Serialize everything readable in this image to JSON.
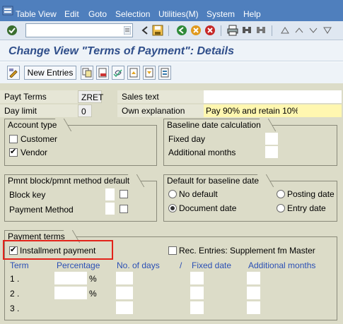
{
  "menu": {
    "items": [
      "Table View",
      "Edit",
      "Goto",
      "Selection",
      "Utilities(M)",
      "System",
      "Help"
    ]
  },
  "title": "Change View \"Terms of Payment\": Details",
  "app_toolbar": {
    "new_entries": "New Entries"
  },
  "fields": {
    "payt_terms": {
      "label": "Payt Terms",
      "value": "ZRET"
    },
    "sales_text": {
      "label": "Sales text",
      "value": ""
    },
    "day_limit": {
      "label": "Day limit",
      "value": "0"
    },
    "own_explanation": {
      "label": "Own explanation",
      "value": "Pay 90% and retain 10%"
    }
  },
  "account_type": {
    "title": "Account type",
    "customer": {
      "label": "Customer",
      "checked": false
    },
    "vendor": {
      "label": "Vendor",
      "checked": true
    }
  },
  "baseline_calc": {
    "title": "Baseline date calculation",
    "fixed_day": "Fixed day",
    "additional_months": "Additional months"
  },
  "pmnt_block": {
    "title": "Pmnt block/pmnt method default",
    "block_key": "Block key",
    "payment_method": "Payment Method"
  },
  "default_baseline": {
    "title": "Default for baseline date",
    "no_default": "No default",
    "document_date": "Document date",
    "posting_date": "Posting date",
    "entry_date": "Entry date",
    "selected": "Document date"
  },
  "payment_terms": {
    "title": "Payment terms",
    "installment": {
      "label": "Installment payment",
      "checked": true
    },
    "rec_entries": {
      "label": "Rec. Entries: Supplement fm Master",
      "checked": false
    },
    "columns": {
      "term": "Term",
      "percentage": "Percentage",
      "days": "No. of days",
      "slash": "/",
      "fixed_date": "Fixed date",
      "add_months": "Additional months"
    },
    "rows": [
      {
        "term": "1 .",
        "pct_sign": "%"
      },
      {
        "term": "2 .",
        "pct_sign": "%"
      },
      {
        "term": "3 .",
        "pct_sign": ""
      }
    ]
  },
  "colors": {
    "menubar": "#4f7fbd",
    "title": "#2f4e8a",
    "panel": "#dcdcc8",
    "highlight": "#fff7b0",
    "callout": "#e2231a",
    "column_header": "#2a4fb5"
  }
}
